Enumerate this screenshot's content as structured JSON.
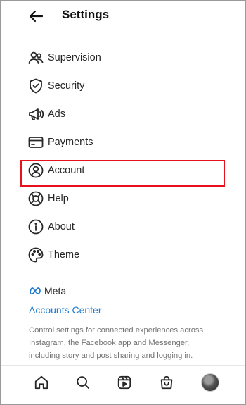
{
  "header": {
    "title": "Settings"
  },
  "menu": {
    "items": [
      {
        "label": "Supervision",
        "icon": "supervision-icon"
      },
      {
        "label": "Security",
        "icon": "shield-icon"
      },
      {
        "label": "Ads",
        "icon": "megaphone-icon"
      },
      {
        "label": "Payments",
        "icon": "card-icon"
      },
      {
        "label": "Account",
        "icon": "account-icon",
        "highlighted": true
      },
      {
        "label": "Help",
        "icon": "lifebuoy-icon"
      },
      {
        "label": "About",
        "icon": "info-icon"
      },
      {
        "label": "Theme",
        "icon": "palette-icon"
      }
    ]
  },
  "meta": {
    "logo_text": "Meta",
    "accounts_center": "Accounts Center",
    "description": "Control settings for connected experiences across Instagram, the Facebook app and Messenger, including story and post sharing and logging in."
  },
  "bottom_nav": {
    "items": [
      "home-icon",
      "search-icon",
      "reels-icon",
      "shop-icon",
      "profile-avatar"
    ]
  },
  "colors": {
    "highlight": "#e8101a",
    "link": "#1f7ad0",
    "text": "#262626",
    "muted": "#737373"
  }
}
